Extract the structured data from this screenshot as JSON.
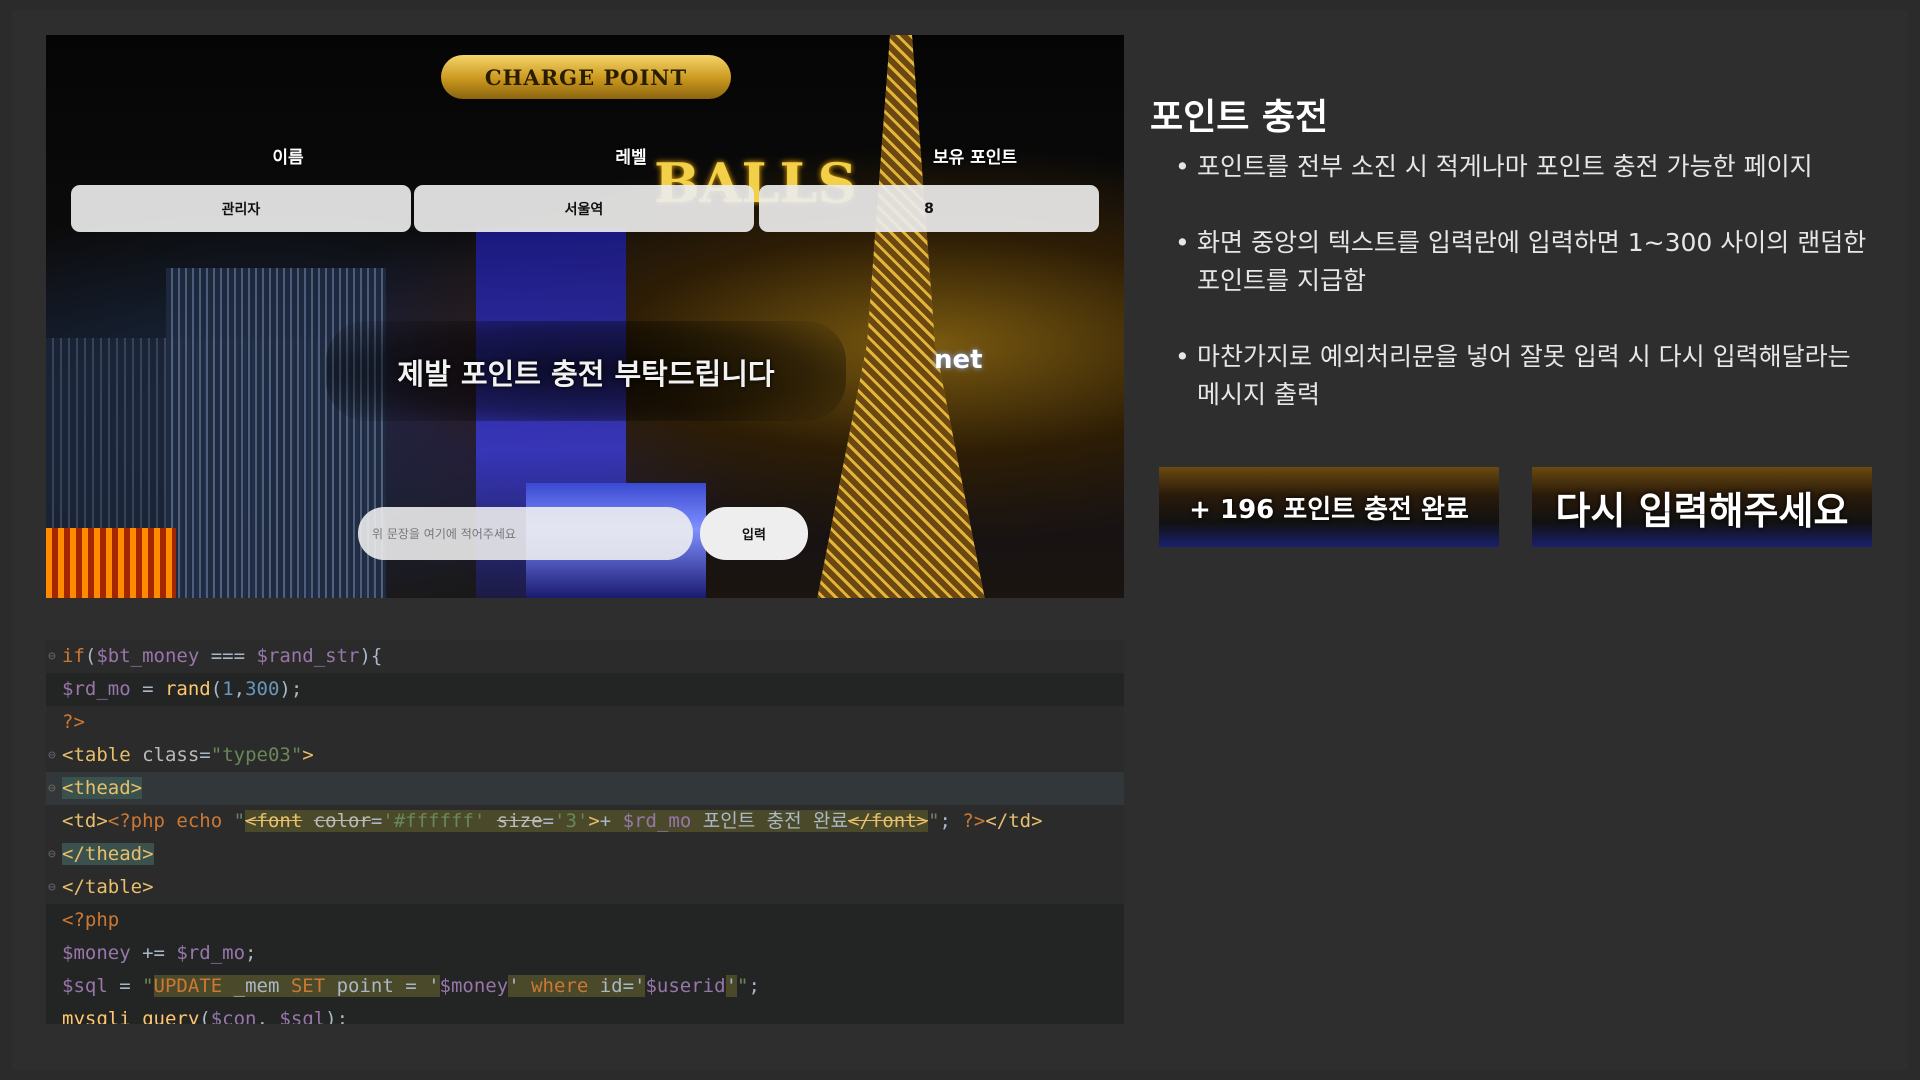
{
  "screenshot": {
    "title": "CHARGE POINT",
    "columns": [
      "이름",
      "레벨",
      "보유 포인트"
    ],
    "values": [
      "관리자",
      "서울역",
      "8"
    ],
    "message": "제발 포인트 충전 부탁드립니다",
    "input_placeholder": "위 문장을 여기에 적어주세요",
    "submit_label": "입력",
    "sign_text": "BALLS",
    "net_sign": "net"
  },
  "code": {
    "lines": [
      {
        "text": "if($bt_money === $rand_str){"
      },
      {
        "text": "$rd_mo = rand(1,300);"
      },
      {
        "text": "?>"
      },
      {
        "text": "<table class=\"type03\">"
      },
      {
        "text": "<thead>"
      },
      {
        "text": "<td><?php echo \"<font color='#ffffff' size='3'>+ $rd_mo 포인트 충전 완료</font>\"; ?></td>"
      },
      {
        "text": "</thead>"
      },
      {
        "text": "</table>"
      },
      {
        "text": "<?php"
      },
      {
        "text": "$money += $rd_mo;"
      },
      {
        "text": "$sql = \"UPDATE _mem SET point = '$money' where id='$userid'\";"
      },
      {
        "text": "mysqli_query($con, $sql);"
      }
    ]
  },
  "heading": "포인트 충전",
  "bullets": [
    "포인트를 전부 소진 시 적게나마 포인트 충전 가능한 페이지",
    "화면 중앙의 텍스트를 입력란에 입력하면 1~300 사이의 랜덤한 포인트를 지급함",
    "마찬가지로 예외처리문을 넣어 잘못 입력 시 다시 입력해달라는 메시지 출력"
  ],
  "previews": {
    "success": "+ 196 포인트 충전 완료",
    "retry": "다시 입력해주세요"
  }
}
